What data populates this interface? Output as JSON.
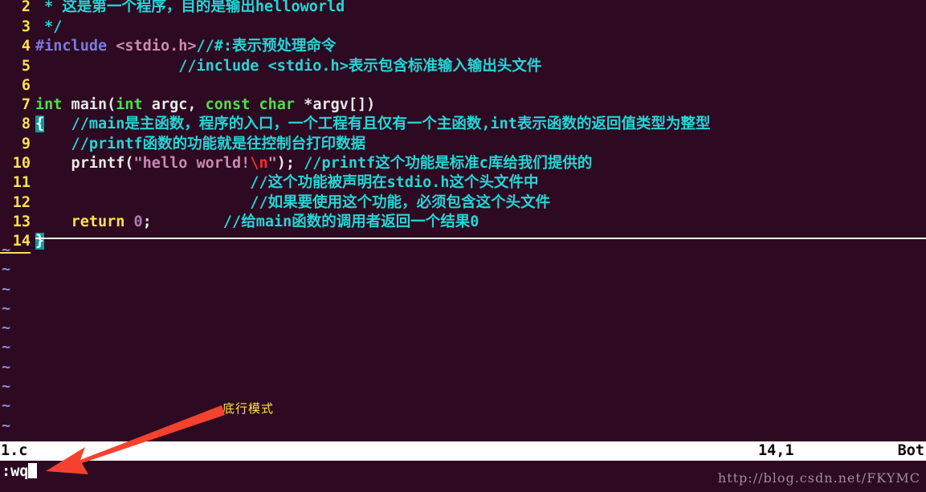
{
  "app": {
    "name": "vim",
    "background_color": "#2d0a22"
  },
  "editor": {
    "lines": [
      {
        "number": "2",
        "tokens": [
          {
            "text": " * ",
            "kind": "comment"
          },
          {
            "text": "这是第一个程序，目的是输出helloworld",
            "kind": "comment"
          }
        ]
      },
      {
        "number": "3",
        "tokens": [
          {
            "text": " */",
            "kind": "comment"
          }
        ]
      },
      {
        "number": "4",
        "tokens": [
          {
            "text": "#include ",
            "kind": "pre"
          },
          {
            "text": "<stdio.h>",
            "kind": "header"
          },
          {
            "text": "//#:表示预处理命令",
            "kind": "comment"
          }
        ]
      },
      {
        "number": "5",
        "tokens": [
          {
            "text": "                //include <stdio.h>表示包含标准输入输出头文件",
            "kind": "comment"
          }
        ]
      },
      {
        "number": "6",
        "tokens": []
      },
      {
        "number": "7",
        "tokens": [
          {
            "text": "int",
            "kind": "keyword"
          },
          {
            "text": " main(",
            "kind": "plain"
          },
          {
            "text": "int",
            "kind": "keyword"
          },
          {
            "text": " argc, ",
            "kind": "plain"
          },
          {
            "text": "const",
            "kind": "keyword"
          },
          {
            "text": " ",
            "kind": "plain"
          },
          {
            "text": "char",
            "kind": "keyword"
          },
          {
            "text": " *argv[])",
            "kind": "plain"
          }
        ]
      },
      {
        "number": "8",
        "tokens": [
          {
            "text": "{",
            "kind": "brace-hi"
          },
          {
            "text": "   ",
            "kind": "plain"
          },
          {
            "text": "//main是主函数，程序的入口，一个工程有且仅有一个主函数,int表示函数的返回值类型为整型",
            "kind": "comment"
          }
        ]
      },
      {
        "number": "9",
        "tokens": [
          {
            "text": "    //printf函数的功能就是往控制台打印数据",
            "kind": "comment"
          }
        ]
      },
      {
        "number": "10",
        "tokens": [
          {
            "text": "    printf(",
            "kind": "plain"
          },
          {
            "text": "\"hello world!",
            "kind": "string"
          },
          {
            "text": "\\n",
            "kind": "escape"
          },
          {
            "text": "\"",
            "kind": "string"
          },
          {
            "text": "); ",
            "kind": "plain"
          },
          {
            "text": "//printf这个功能是标准c库给我们提供的",
            "kind": "comment"
          }
        ]
      },
      {
        "number": "11",
        "tokens": [
          {
            "text": "                        //这个功能被声明在stdio.h这个头文件中",
            "kind": "comment"
          }
        ]
      },
      {
        "number": "12",
        "tokens": [
          {
            "text": "                        //如果要使用这个功能，必须包含这个头文件",
            "kind": "comment"
          }
        ]
      },
      {
        "number": "13",
        "tokens": [
          {
            "text": "    ",
            "kind": "plain"
          },
          {
            "text": "return",
            "kind": "return"
          },
          {
            "text": " ",
            "kind": "plain"
          },
          {
            "text": "0",
            "kind": "number"
          },
          {
            "text": ";",
            "kind": "plain"
          },
          {
            "text": "        ",
            "kind": "plain"
          },
          {
            "text": "//给main函数的调用者返回一个结果0",
            "kind": "comment"
          }
        ]
      },
      {
        "number": "14",
        "underlined": true,
        "tokens": [
          {
            "text": "}",
            "kind": "brace-hi"
          }
        ]
      }
    ],
    "tilde_glyph": "~",
    "tilde_count": 11
  },
  "statusline": {
    "filename": "1.c",
    "position": "14,1",
    "scroll": "Bot"
  },
  "cmdline": {
    "text": ":wq"
  },
  "annotation": {
    "label": "底行模式",
    "arrow_color": "#f4422e"
  },
  "watermark": {
    "text": "http://blog.csdn.net/FKYMC"
  }
}
